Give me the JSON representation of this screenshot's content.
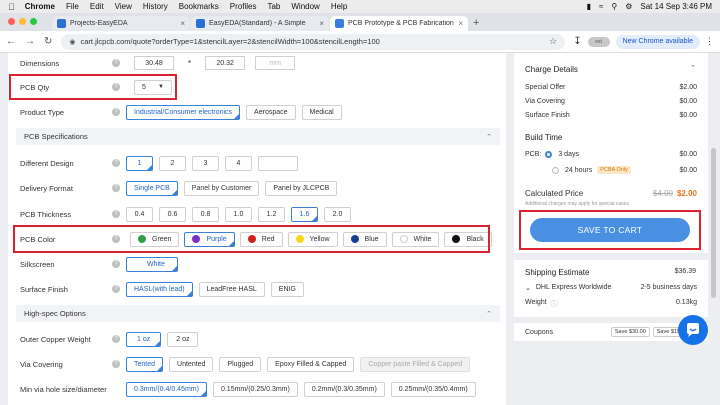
{
  "menubar": {
    "app": "Chrome",
    "items": [
      "File",
      "Edit",
      "View",
      "History",
      "Bookmarks",
      "Profiles",
      "Tab",
      "Window",
      "Help"
    ],
    "clock": "Sat 14 Sep 3:46 PM"
  },
  "tabs": [
    {
      "title": "Projects-EasyEDA",
      "color": "#2b6fd6"
    },
    {
      "title": "EasyEDA(Standard) - A Simple",
      "color": "#2b6fd6"
    },
    {
      "title": "PCB Prototype & PCB Fabrication",
      "color": "#3a7be0"
    }
  ],
  "addressbar": {
    "url": "cart.jlcpcb.com/quote?orderType=1&stencilLayer=2&stencilWidth=100&stencilLength=100",
    "new_chrome": "New Chrome available",
    "ext_label": "ext"
  },
  "form": {
    "dimensions": {
      "label": "Dimensions",
      "w": "30.48",
      "x": "*",
      "h": "20.32",
      "unit": "mm"
    },
    "qty": {
      "label": "PCB Qty",
      "value": "5"
    },
    "product_type": {
      "label": "Product Type",
      "options": [
        "Industrial/Consumer electronics",
        "Aerospace",
        "Medical"
      ],
      "selected": 0
    },
    "sec_specs": "PCB Specifications",
    "different_design": {
      "label": "Different Design",
      "options": [
        "1",
        "2",
        "3",
        "4"
      ],
      "selected": 0
    },
    "delivery": {
      "label": "Delivery Format",
      "options": [
        "Single PCB",
        "Panel by Customer",
        "Panel by JLCPCB"
      ],
      "selected": 0
    },
    "thickness": {
      "label": "PCB Thickness",
      "options": [
        "0.4",
        "0.6",
        "0.8",
        "1.0",
        "1.2",
        "1.6",
        "2.0"
      ],
      "selected": 5
    },
    "color": {
      "label": "PCB Color",
      "options": [
        {
          "name": "Green",
          "hex": "#2e9e4f"
        },
        {
          "name": "Purple",
          "hex": "#7b2fc9"
        },
        {
          "name": "Red",
          "hex": "#d21f1f"
        },
        {
          "name": "Yellow",
          "hex": "#f3d81a"
        },
        {
          "name": "Blue",
          "hex": "#1b3f8f"
        },
        {
          "name": "White",
          "hex": "#ffffff"
        },
        {
          "name": "Black",
          "hex": "#111111"
        }
      ],
      "selected": 1
    },
    "silkscreen": {
      "label": "Silkscreen",
      "value": "White"
    },
    "surface": {
      "label": "Surface Finish",
      "options": [
        "HASL(with lead)",
        "LeadFree HASL",
        "ENIG"
      ],
      "selected": 0
    },
    "sec_high": "High-spec Options",
    "copper": {
      "label": "Outer Copper Weight",
      "options": [
        "1 oz",
        "2 oz"
      ],
      "selected": 0
    },
    "via": {
      "label": "Via Covering",
      "options": [
        "Tented",
        "Untented",
        "Plugged",
        "Epoxy Filled & Capped",
        "Copper paste Filled & Capped"
      ],
      "selected": 0
    },
    "minvia": {
      "label": "Min via hole size/diameter",
      "options": [
        "0.3mm/(0.4/0.45mm)",
        "0.15mm/(0.25/0.3mm)",
        "0.2mm/(0.3/0.35mm)",
        "0.25mm/(0.35/0.4mm)"
      ],
      "selected": 0
    }
  },
  "charges": {
    "title": "Charge Details",
    "lines": [
      {
        "name": "Special Offer",
        "value": "$2.00"
      },
      {
        "name": "Via Covering",
        "value": "$0.00"
      },
      {
        "name": "Surface Finish",
        "value": "$0.00"
      }
    ],
    "build_title": "Build Time",
    "build": {
      "pcb_label": "PCB:",
      "opt1": "3 days",
      "opt1_price": "$0.00",
      "opt2": "24 hours",
      "pcba": "PCBA Only",
      "opt2_price": "$0.00"
    },
    "calc_label": "Calculated Price",
    "old_price": "$4.00",
    "new_price": "$2.00",
    "note": "Additional charges may apply for special cases",
    "save": "SAVE TO CART"
  },
  "shipping": {
    "title": "Shipping Estimate",
    "price": "$36.39",
    "method": "DHL Express Worldwide",
    "days": "2-5 business days",
    "weight_label": "Weight",
    "weight": "0.13kg"
  },
  "coupons": {
    "label": "Coupons",
    "c1": "Save $30.00",
    "c2": "Save $15.00"
  },
  "colors": {
    "accent": "#3b82d6",
    "highlight": "#d9232e",
    "price": "#e8731a"
  }
}
